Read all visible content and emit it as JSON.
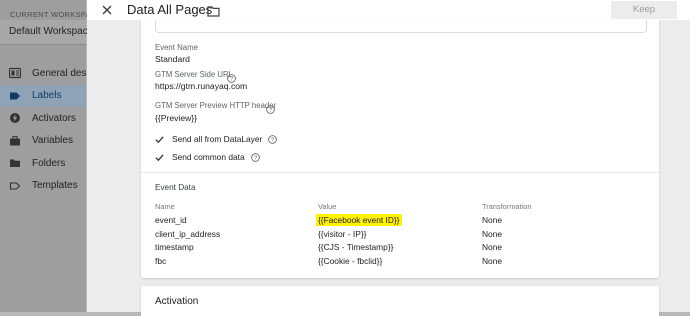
{
  "sidebar": {
    "workspace_caption": "CURRENT WORKSPACE",
    "workspace_name": "Default Workspace",
    "items": [
      {
        "label": "General descr",
        "icon": "info-icon",
        "active": false
      },
      {
        "label": "Labels",
        "icon": "label-icon",
        "active": true
      },
      {
        "label": "Activators",
        "icon": "bolt-icon",
        "active": false
      },
      {
        "label": "Variables",
        "icon": "briefcase-icon",
        "active": false
      },
      {
        "label": "Folders",
        "icon": "folder-icon",
        "active": false
      },
      {
        "label": "Templates",
        "icon": "label-outline-icon",
        "active": false
      }
    ]
  },
  "header": {
    "title": "Data All Pages",
    "keep_label": "Keep"
  },
  "config": {
    "event_name_label": "Event Name",
    "event_name_value": "Standard",
    "server_url_label": "GTM Server Side URL",
    "server_url_value": "https://gtm.runayaq.com",
    "preview_header_label": "GTM Server Preview HTTP header",
    "preview_header_value": "{{Preview}}",
    "send_datalayer_label": "Send all from DataLayer",
    "send_common_label": "Send common data"
  },
  "event_data": {
    "section_title": "Event Data",
    "columns": [
      "Name",
      "Value",
      "Transformation"
    ],
    "rows": [
      {
        "name": "event_id",
        "value": "{{Facebook event ID}}",
        "transformation": "None",
        "highlighted": true
      },
      {
        "name": "client_ip_address",
        "value": "{{visitor - IP}}",
        "transformation": "None",
        "highlighted": false
      },
      {
        "name": "timestamp",
        "value": "{{CJS - Timestamp}}",
        "transformation": "None",
        "highlighted": false
      },
      {
        "name": "fbc",
        "value": "{{Cookie - fbclid}}",
        "transformation": "None",
        "highlighted": false
      }
    ]
  },
  "activation": {
    "title": "Activation"
  },
  "colors": {
    "highlight": "#fff200",
    "active_nav_bg": "#8fa3b6",
    "active_nav_text": "#0d3b66"
  }
}
